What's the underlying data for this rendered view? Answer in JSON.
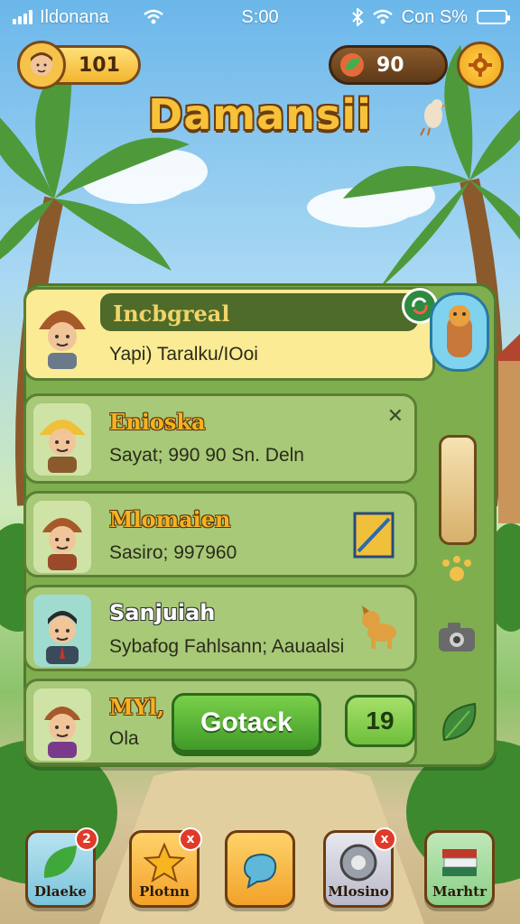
{
  "status_bar": {
    "carrier": "Ildonana",
    "time": "S:00",
    "right_text": "Con S%"
  },
  "hud": {
    "player_score": "101",
    "gem_count": "90"
  },
  "game_title": "Damansii",
  "cards": [
    {
      "name": "Incbgreal",
      "sub": "Yapi) Taralku/IOoi"
    },
    {
      "name": "Enioska",
      "sub": "Sayat; 990 90 Sn. Deln"
    },
    {
      "name": "Mlomaien",
      "sub": "Sasiro; 997960"
    },
    {
      "name": "Sanjuiah",
      "sub": "Sybafog Fahlsann; Aauaalsi"
    },
    {
      "name": "MYl,",
      "sub": "Ola"
    }
  ],
  "action": {
    "go_label": "Gotack",
    "count": "19"
  },
  "nav": [
    {
      "label": "Dlaeke",
      "badge": "2"
    },
    {
      "label": "Plotnn",
      "badge": "x"
    },
    {
      "label": ""
    },
    {
      "label": "Mlosino",
      "badge": "x"
    },
    {
      "label": "Marhtr"
    }
  ],
  "colors": {
    "sky": "#6bb7ea",
    "panel": "#7fae4e",
    "accent_yellow": "#f6b21f",
    "button_green": "#3f9a28",
    "notification_red": "#e03a2a"
  }
}
